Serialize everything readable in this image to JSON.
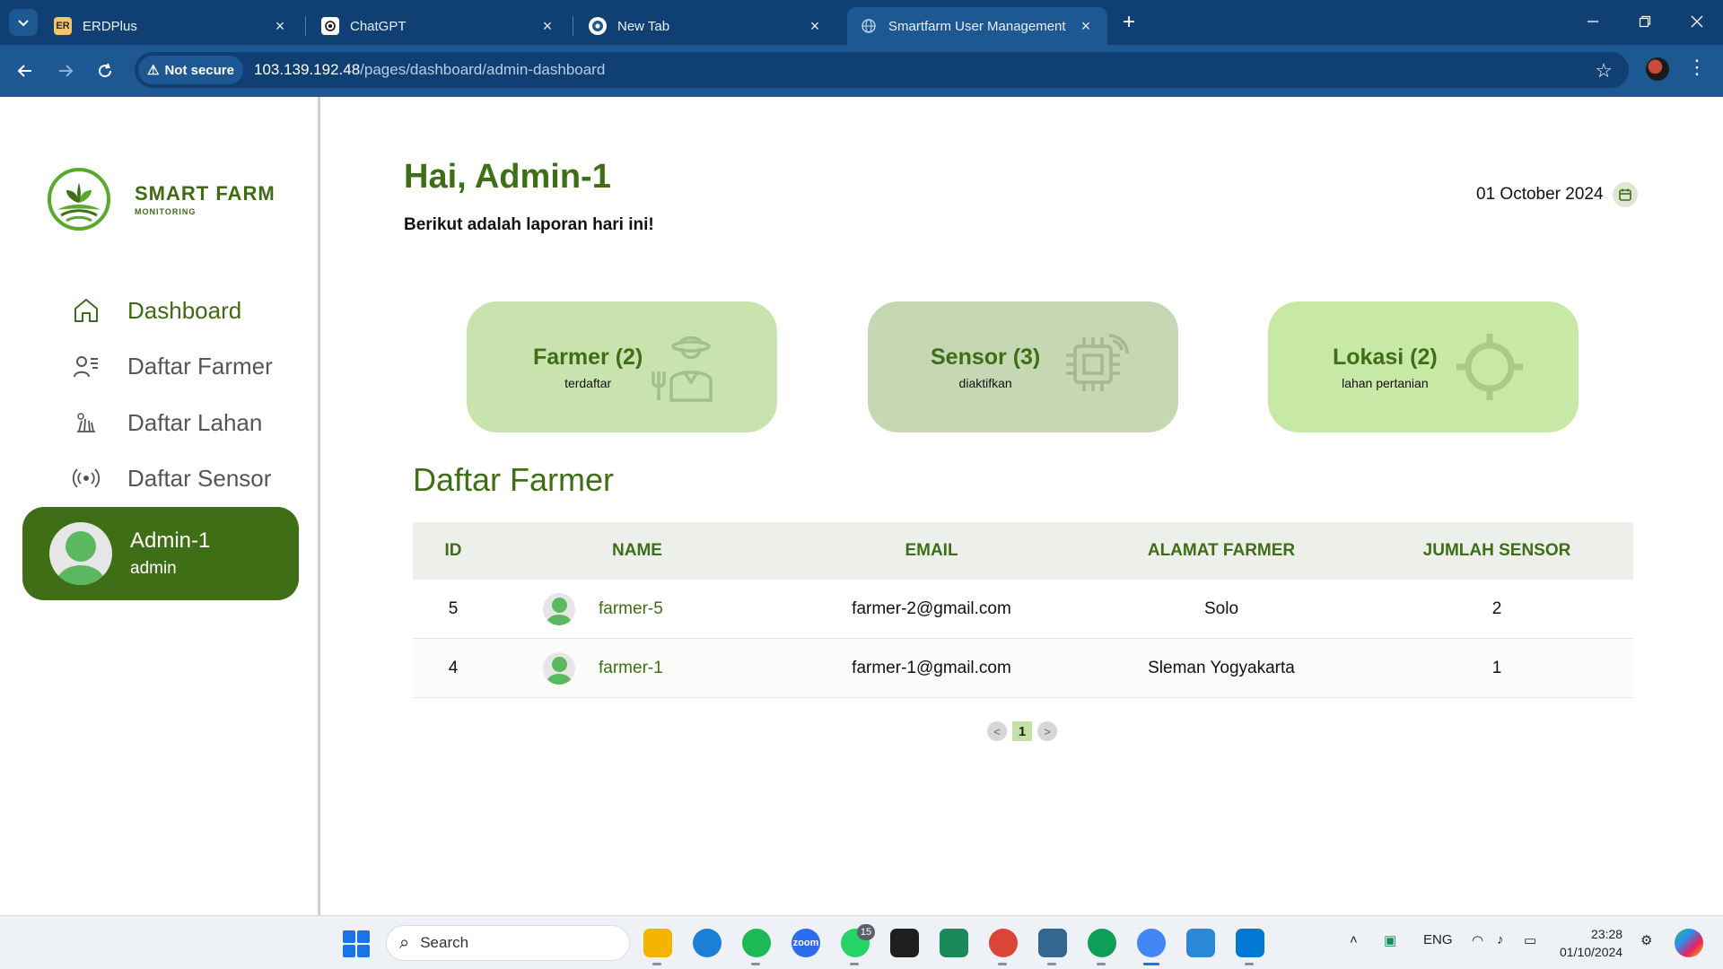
{
  "browser": {
    "tabs": [
      {
        "title": "ERDPlus",
        "favicon": "ER"
      },
      {
        "title": "ChatGPT",
        "favicon": "chatgpt-icon"
      },
      {
        "title": "New Tab",
        "favicon": "chrome-icon"
      },
      {
        "title": "Smartfarm User Management",
        "favicon": "globe-icon",
        "active": true
      }
    ],
    "security_label": "Not secure",
    "url_host": "103.139.192.48",
    "url_path": "/pages/dashboard/admin-dashboard"
  },
  "sidebar": {
    "logo_title": "SMART FARM",
    "logo_subtitle": "MONITORING",
    "items": [
      {
        "label": "Dashboard",
        "icon": "home-icon",
        "active": true
      },
      {
        "label": "Daftar Farmer",
        "icon": "user-list-icon"
      },
      {
        "label": "Daftar Lahan",
        "icon": "field-icon"
      },
      {
        "label": "Daftar Sensor",
        "icon": "broadcast-icon"
      }
    ],
    "user": {
      "name": "Admin-1",
      "role": "admin"
    }
  },
  "header": {
    "greeting": "Hai, Admin-1",
    "subtitle": "Berikut adalah laporan hari ini!",
    "date": "01 October 2024"
  },
  "stats": [
    {
      "title": "Farmer (2)",
      "subtitle": "terdaftar",
      "icon": "farmer-icon",
      "color": "#c8e3ad"
    },
    {
      "title": "Sensor (3)",
      "subtitle": "diaktifkan",
      "icon": "chip-icon",
      "color": "#c6d7b4"
    },
    {
      "title": "Lokasi (2)",
      "subtitle": "lahan pertanian",
      "icon": "location-icon",
      "color": "#c8e8a6"
    }
  ],
  "farmer_table": {
    "title": "Daftar Farmer",
    "columns": [
      "ID",
      "NAME",
      "EMAIL",
      "ALAMAT FARMER",
      "JUMLAH SENSOR"
    ],
    "rows": [
      {
        "id": "5",
        "name": "farmer-5",
        "email": "farmer-2@gmail.com",
        "address": "Solo",
        "sensors": "2"
      },
      {
        "id": "4",
        "name": "farmer-1",
        "email": "farmer-1@gmail.com",
        "address": "Sleman Yogyakarta",
        "sensors": "1"
      }
    ],
    "pagination": {
      "prev": "<",
      "current": "1",
      "next": ">"
    }
  },
  "taskbar": {
    "search_placeholder": "Search",
    "whatsapp_badge": "15",
    "language": "ENG",
    "time": "23:28",
    "date": "01/10/2024"
  },
  "colors": {
    "brand_green": "#3e6e15",
    "chrome_dark": "#0f3f73",
    "chrome_light": "#1d5893"
  }
}
